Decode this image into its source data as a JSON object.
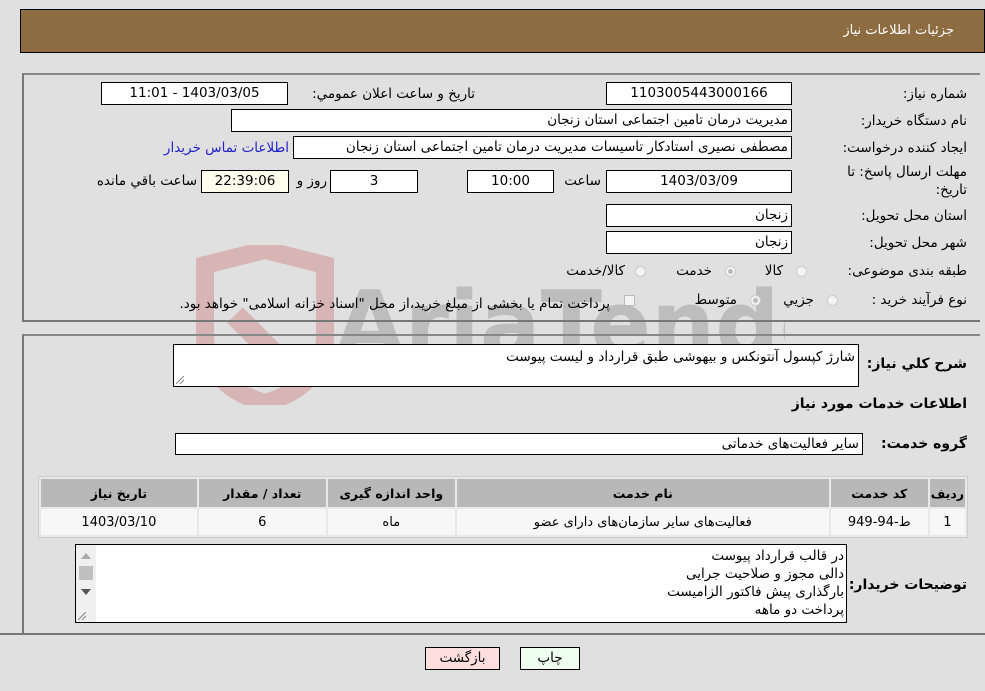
{
  "header": {
    "title": "جزئیات اطلاعات نیاز"
  },
  "fields": {
    "need_number_label": "شماره نیاز:",
    "need_number": "1103005443000166",
    "announce_label": "تاریخ و ساعت اعلان عمومي:",
    "announce_value": "1403/03/05 - 11:01",
    "buyer_org_label": "نام دستگاه خریدار:",
    "buyer_org": "مدیریت درمان تامین اجتماعی استان زنجان",
    "creator_label": "ایجاد کننده درخواست:",
    "creator": "مصطفی نصیری استادکار تاسیسات مدیریت درمان تامین اجتماعی استان زنجان",
    "contact_link": "اطلاعات تماس خریدار",
    "deadline_label_line1": "مهلت ارسال پاسخ: تا",
    "deadline_label_line2": "تاریخ:",
    "deadline_date": "1403/03/09",
    "time_label": "ساعت",
    "deadline_time": "10:00",
    "days_value": "3",
    "days_label": "روز و",
    "remaining_time": "22:39:06",
    "remaining_label": "ساعت باقي مانده",
    "province_label": "استان محل تحویل:",
    "province": "زنجان",
    "city_label": "شهر محل تحویل:",
    "city": "زنجان",
    "category_label": "طبقه بندی موضوعی:",
    "category_options": [
      "کالا",
      "خدمت",
      "کالا/خدمت"
    ],
    "category_selected": "خدمت",
    "process_label": "نوع فرآیند خرید :",
    "process_options": [
      "جزيي",
      "متوسط"
    ],
    "process_selected": "متوسط",
    "treasury_note": "پرداخت تمام یا بخشی از مبلغ خرید،از محل \"اسناد خزانه اسلامی\" خواهد بود."
  },
  "description": {
    "label": "شرح كلي نیاز:",
    "value": "شارژ کپسول آنتونکس و بیهوشی طبق قرارداد و لیست پیوست"
  },
  "services": {
    "section_title": "اطلاعات خدمات مورد نیاز",
    "group_label": "گروه خدمت:",
    "group_value": "سایر فعالیت‌های خدماتی",
    "columns": [
      "ردیف",
      "کد خدمت",
      "نام خدمت",
      "واحد اندازه گیری",
      "تعداد / مقدار",
      "تاریخ نیاز"
    ],
    "rows": [
      [
        "1",
        "ط-94-949",
        "فعالیت‌های سایر سازمان‌های دارای عضو",
        "ماه",
        "6",
        "1403/03/10"
      ]
    ]
  },
  "buyer_notes": {
    "label": "توضیحات خریدار:",
    "lines": [
      "در قالب قرارداد پیوست",
      "دالی مجوز و صلاحیت جرایی",
      "بارگذاری پیش فاکتور الزامیست",
      "پرداخت دو ماهه"
    ]
  },
  "buttons": {
    "print": "چاپ",
    "back": "بازگشت"
  },
  "colors": {
    "header_bg": "#8e6c42",
    "print_bg": "#efffef",
    "back_bg": "#ffdede",
    "link": "#2222cc"
  },
  "watermark": "AriaTender.net"
}
